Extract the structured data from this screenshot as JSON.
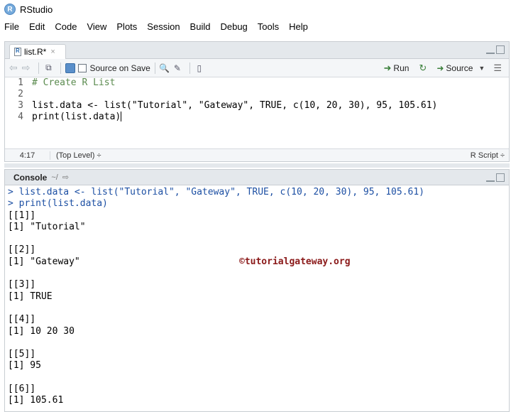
{
  "window": {
    "title": "RStudio",
    "logo_text": "R"
  },
  "menu": [
    "File",
    "Edit",
    "Code",
    "View",
    "Plots",
    "Session",
    "Build",
    "Debug",
    "Tools",
    "Help"
  ],
  "editor": {
    "tab_label": "list.R*",
    "tab_close": "×",
    "toolbar": {
      "source_on_save": "Source on Save",
      "run": "Run",
      "source": "Source"
    },
    "lines": [
      {
        "num": "1",
        "text": "# Create R List"
      },
      {
        "num": "2",
        "text": ""
      },
      {
        "num": "3",
        "text": "list.data <- list(\"Tutorial\", \"Gateway\", TRUE, c(10, 20, 30), 95, 105.61)"
      },
      {
        "num": "4",
        "text": "print(list.data)"
      }
    ],
    "status": {
      "position": "4:17",
      "scope": "(Top Level) ÷",
      "file_type": "R Script ÷"
    }
  },
  "console": {
    "title": "Console",
    "path": "~/",
    "lines": [
      {
        "kind": "prompt",
        "text": "> list.data <- list(\"Tutorial\", \"Gateway\", TRUE, c(10, 20, 30), 95, 105.61)"
      },
      {
        "kind": "prompt",
        "text": "> print(list.data)"
      },
      {
        "kind": "out",
        "text": "[[1]]"
      },
      {
        "kind": "out",
        "text": "[1] \"Tutorial\""
      },
      {
        "kind": "out",
        "text": ""
      },
      {
        "kind": "out",
        "text": "[[2]]"
      },
      {
        "kind": "out",
        "text": "[1] \"Gateway\""
      },
      {
        "kind": "out",
        "text": ""
      },
      {
        "kind": "out",
        "text": "[[3]]"
      },
      {
        "kind": "out",
        "text": "[1] TRUE"
      },
      {
        "kind": "out",
        "text": ""
      },
      {
        "kind": "out",
        "text": "[[4]]"
      },
      {
        "kind": "out",
        "text": "[1] 10 20 30"
      },
      {
        "kind": "out",
        "text": ""
      },
      {
        "kind": "out",
        "text": "[[5]]"
      },
      {
        "kind": "out",
        "text": "[1] 95"
      },
      {
        "kind": "out",
        "text": ""
      },
      {
        "kind": "out",
        "text": "[[6]]"
      },
      {
        "kind": "out",
        "text": "[1] 105.61"
      }
    ],
    "watermark": "©tutorialgateway.org"
  }
}
